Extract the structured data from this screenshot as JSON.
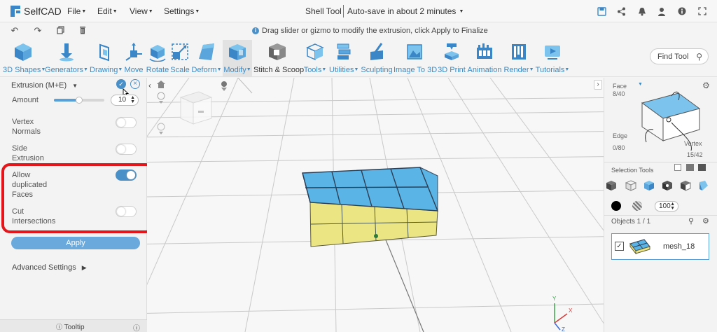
{
  "app": {
    "name": "SelfCAD"
  },
  "menu": {
    "items": [
      "File",
      "Edit",
      "View",
      "Settings"
    ]
  },
  "document": {
    "title": "Shell Tool",
    "autosave": "Auto-save in about 2 minutes"
  },
  "hint": {
    "text": "Drag slider or gizmo to modify the extrusion, click Apply to Finalize"
  },
  "toolbar": {
    "tools": [
      {
        "label": "3D Shapes",
        "dropdown": true
      },
      {
        "label": "Generators",
        "dropdown": true
      },
      {
        "label": "Drawing",
        "dropdown": true
      },
      {
        "label": "Move",
        "dropdown": false
      },
      {
        "label": "Rotate",
        "dropdown": false
      },
      {
        "label": "Scale",
        "dropdown": false
      },
      {
        "label": "Deform",
        "dropdown": true
      },
      {
        "label": "Modify",
        "dropdown": true,
        "active": true
      },
      {
        "label": "Stitch & Scoop",
        "dropdown": false
      },
      {
        "label": "Tools",
        "dropdown": true
      },
      {
        "label": "Utilities",
        "dropdown": true
      },
      {
        "label": "Sculpting",
        "dropdown": false
      },
      {
        "label": "Image To 3D",
        "dropdown": false
      },
      {
        "label": "3D Print",
        "dropdown": false
      },
      {
        "label": "Animation",
        "dropdown": false
      },
      {
        "label": "Render",
        "dropdown": true
      },
      {
        "label": "Tutorials",
        "dropdown": true
      }
    ],
    "find_placeholder": "Find Tool"
  },
  "extrusion_panel": {
    "title": "Extrusion (M+E)",
    "amount_label": "Amount",
    "amount_value": "10",
    "amount_slider_fraction": 0.5,
    "options": [
      {
        "label": "Vertex Normals",
        "on": false
      },
      {
        "label": "Side Extrusion",
        "on": false
      },
      {
        "label": "Allow duplicated Faces",
        "on": true
      },
      {
        "label": "Cut Intersections",
        "on": false
      }
    ],
    "apply_label": "Apply",
    "advanced_label": "Advanced Settings",
    "tooltip_label": "Tooltip"
  },
  "right_panel": {
    "face_label": "Face",
    "face_count": "8/40",
    "edge_label": "Edge",
    "edge_count": "0/80",
    "vertex_label": "Vertex",
    "vertex_count": "15/42",
    "selection_tools_label": "Selection Tools",
    "opacity_value": "100",
    "objects_label": "Objects 1 / 1",
    "object_name": "mesh_18"
  },
  "colors": {
    "accent": "#4a90c8",
    "tool_label": "#3b8ac4",
    "highlight_annotation": "#e4161b",
    "face_selected": "#5ab4e5",
    "face_side": "#ece583"
  }
}
